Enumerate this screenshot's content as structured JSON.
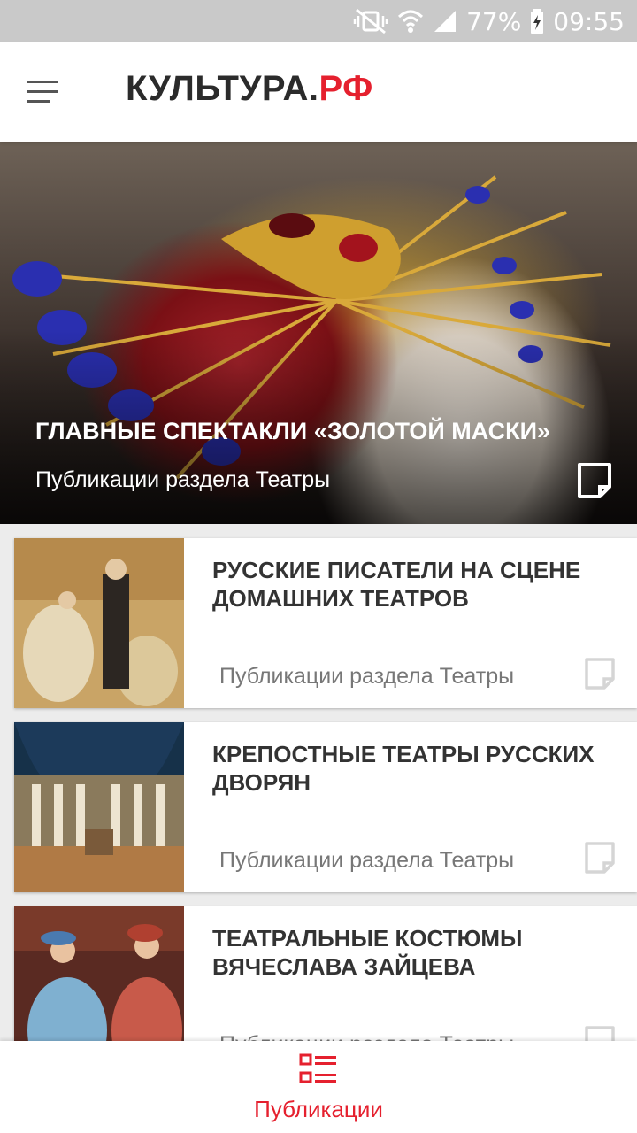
{
  "status_bar": {
    "battery": "77%",
    "time": "09:55",
    "icons": [
      "mute-vibrate-icon",
      "wifi-icon",
      "signal-icon",
      "battery-charging-icon"
    ]
  },
  "app_bar": {
    "logo_main": "КУЛЬТУРА.",
    "logo_accent": "РФ",
    "menu_icon": "hamburger-menu-icon"
  },
  "colors": {
    "accent": "#e5202e",
    "status_bar_bg": "#c9c9c9",
    "text_dark": "#333333",
    "text_muted": "#777777"
  },
  "hero": {
    "title": "ГЛАВНЫЕ СПЕКТАКЛИ «ЗОЛОТОЙ МАСКИ»",
    "subtitle": "Публикации раздела Театры",
    "bookmark_icon": "bookmark-icon"
  },
  "cards": [
    {
      "title": "РУССКИЕ ПИСАТЕЛИ НА СЦЕНЕ ДОМАШНИХ ТЕАТРОВ",
      "subtitle": "Публикации раздела Театры"
    },
    {
      "title": "КРЕПОСТНЫЕ ТЕАТРЫ РУССКИХ ДВОРЯН",
      "subtitle": "Публикации раздела Театры"
    },
    {
      "title": "ТЕАТРАЛЬНЫЕ КОСТЮМЫ ВЯЧЕСЛАВА ЗАЙЦЕВА",
      "subtitle": "Публикации раздела Театры"
    }
  ],
  "bottom_nav": {
    "label": "Публикации",
    "icon": "publications-list-icon"
  }
}
